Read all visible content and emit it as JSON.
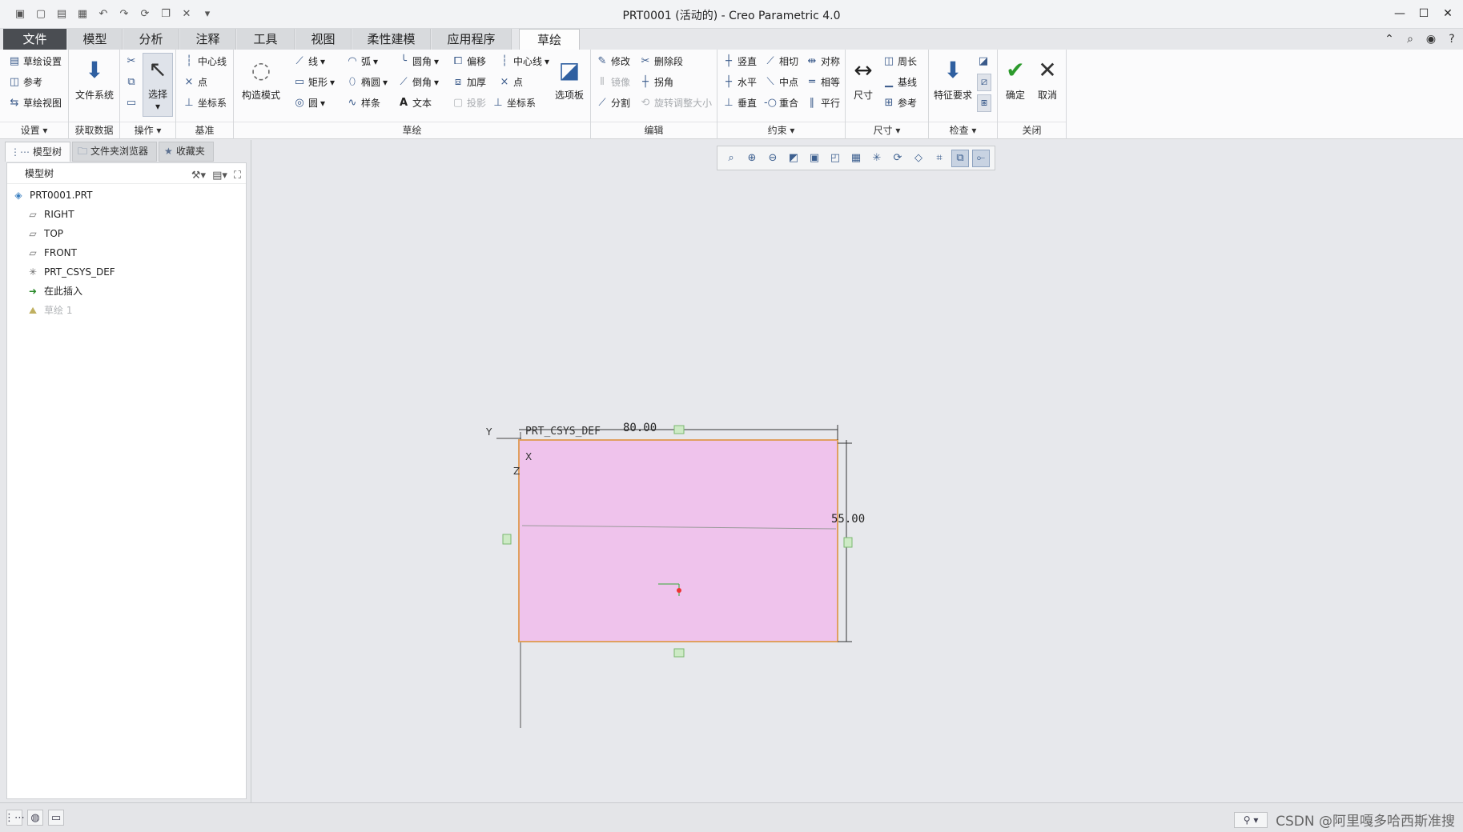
{
  "window": {
    "title": "PRT0001 (活动的) - Creo Parametric 4.0"
  },
  "tabs": [
    {
      "label": "文件"
    },
    {
      "label": "模型"
    },
    {
      "label": "分析"
    },
    {
      "label": "注释"
    },
    {
      "label": "工具"
    },
    {
      "label": "视图"
    },
    {
      "label": "柔性建模"
    },
    {
      "label": "应用程序"
    },
    {
      "label": "草绘"
    }
  ],
  "ribbon": {
    "setup": {
      "items": [
        "草绘设置",
        "参考",
        "草绘视图"
      ],
      "label": "设置"
    },
    "get_data": {
      "items": [
        "文件系统"
      ],
      "label": "获取数据"
    },
    "operations": {
      "items": [
        "选择"
      ],
      "label": "操作"
    },
    "datum": {
      "items": [
        "中心线",
        "点",
        "坐标系"
      ],
      "label": "基准"
    },
    "sketch": {
      "construction": "构造模式",
      "items": [
        "线",
        "弧",
        "圆角",
        "偏移",
        "中心线",
        "矩形",
        "椭圆",
        "倒角",
        "加厚",
        "点",
        "圆",
        "样条",
        "文本",
        "投影",
        "坐标系"
      ],
      "palette": "选项板",
      "label": "草绘"
    },
    "edit": {
      "items": [
        "修改",
        "删除段",
        "镜像",
        "拐角",
        "分割",
        "旋转调整大小"
      ],
      "label": "编辑"
    },
    "constrain": {
      "items": [
        "竖直",
        "相切",
        "对称",
        "水平",
        "中点",
        "相等",
        "垂直",
        "重合",
        "平行"
      ],
      "label": "约束"
    },
    "dimension": {
      "big": "尺寸",
      "items": [
        "周长",
        "基线",
        "参考"
      ],
      "label": "尺寸"
    },
    "inspect": {
      "big": "特征要求",
      "label": "检查"
    },
    "close": {
      "ok": "确定",
      "cancel": "取消",
      "label": "关闭"
    }
  },
  "left_panel": {
    "tabs": [
      {
        "label": "模型树"
      },
      {
        "label": "文件夹浏览器"
      },
      {
        "label": "收藏夹"
      }
    ],
    "header": "模型树",
    "items": [
      {
        "label": "PRT0001.PRT",
        "icon": "part-icon"
      },
      {
        "label": "RIGHT",
        "icon": "datum-plane-icon"
      },
      {
        "label": "TOP",
        "icon": "datum-plane-icon"
      },
      {
        "label": "FRONT",
        "icon": "datum-plane-icon"
      },
      {
        "label": "PRT_CSYS_DEF",
        "icon": "csys-icon"
      },
      {
        "label": "在此插入",
        "icon": "insert-arrow-icon"
      },
      {
        "label": "草绘 1",
        "icon": "sketch-icon"
      }
    ]
  },
  "sketch": {
    "csys_label": "PRT_CSYS_DEF",
    "axis_y": "Y",
    "axis_x": "X",
    "axis_z": "Z",
    "dim_width": "80.00",
    "dim_height": "55.00",
    "fill_color": "#efc3ec",
    "edge_color": "#e0a060"
  },
  "status": {
    "watermark": "CSDN @阿里嘎多哈西斯准搜"
  }
}
